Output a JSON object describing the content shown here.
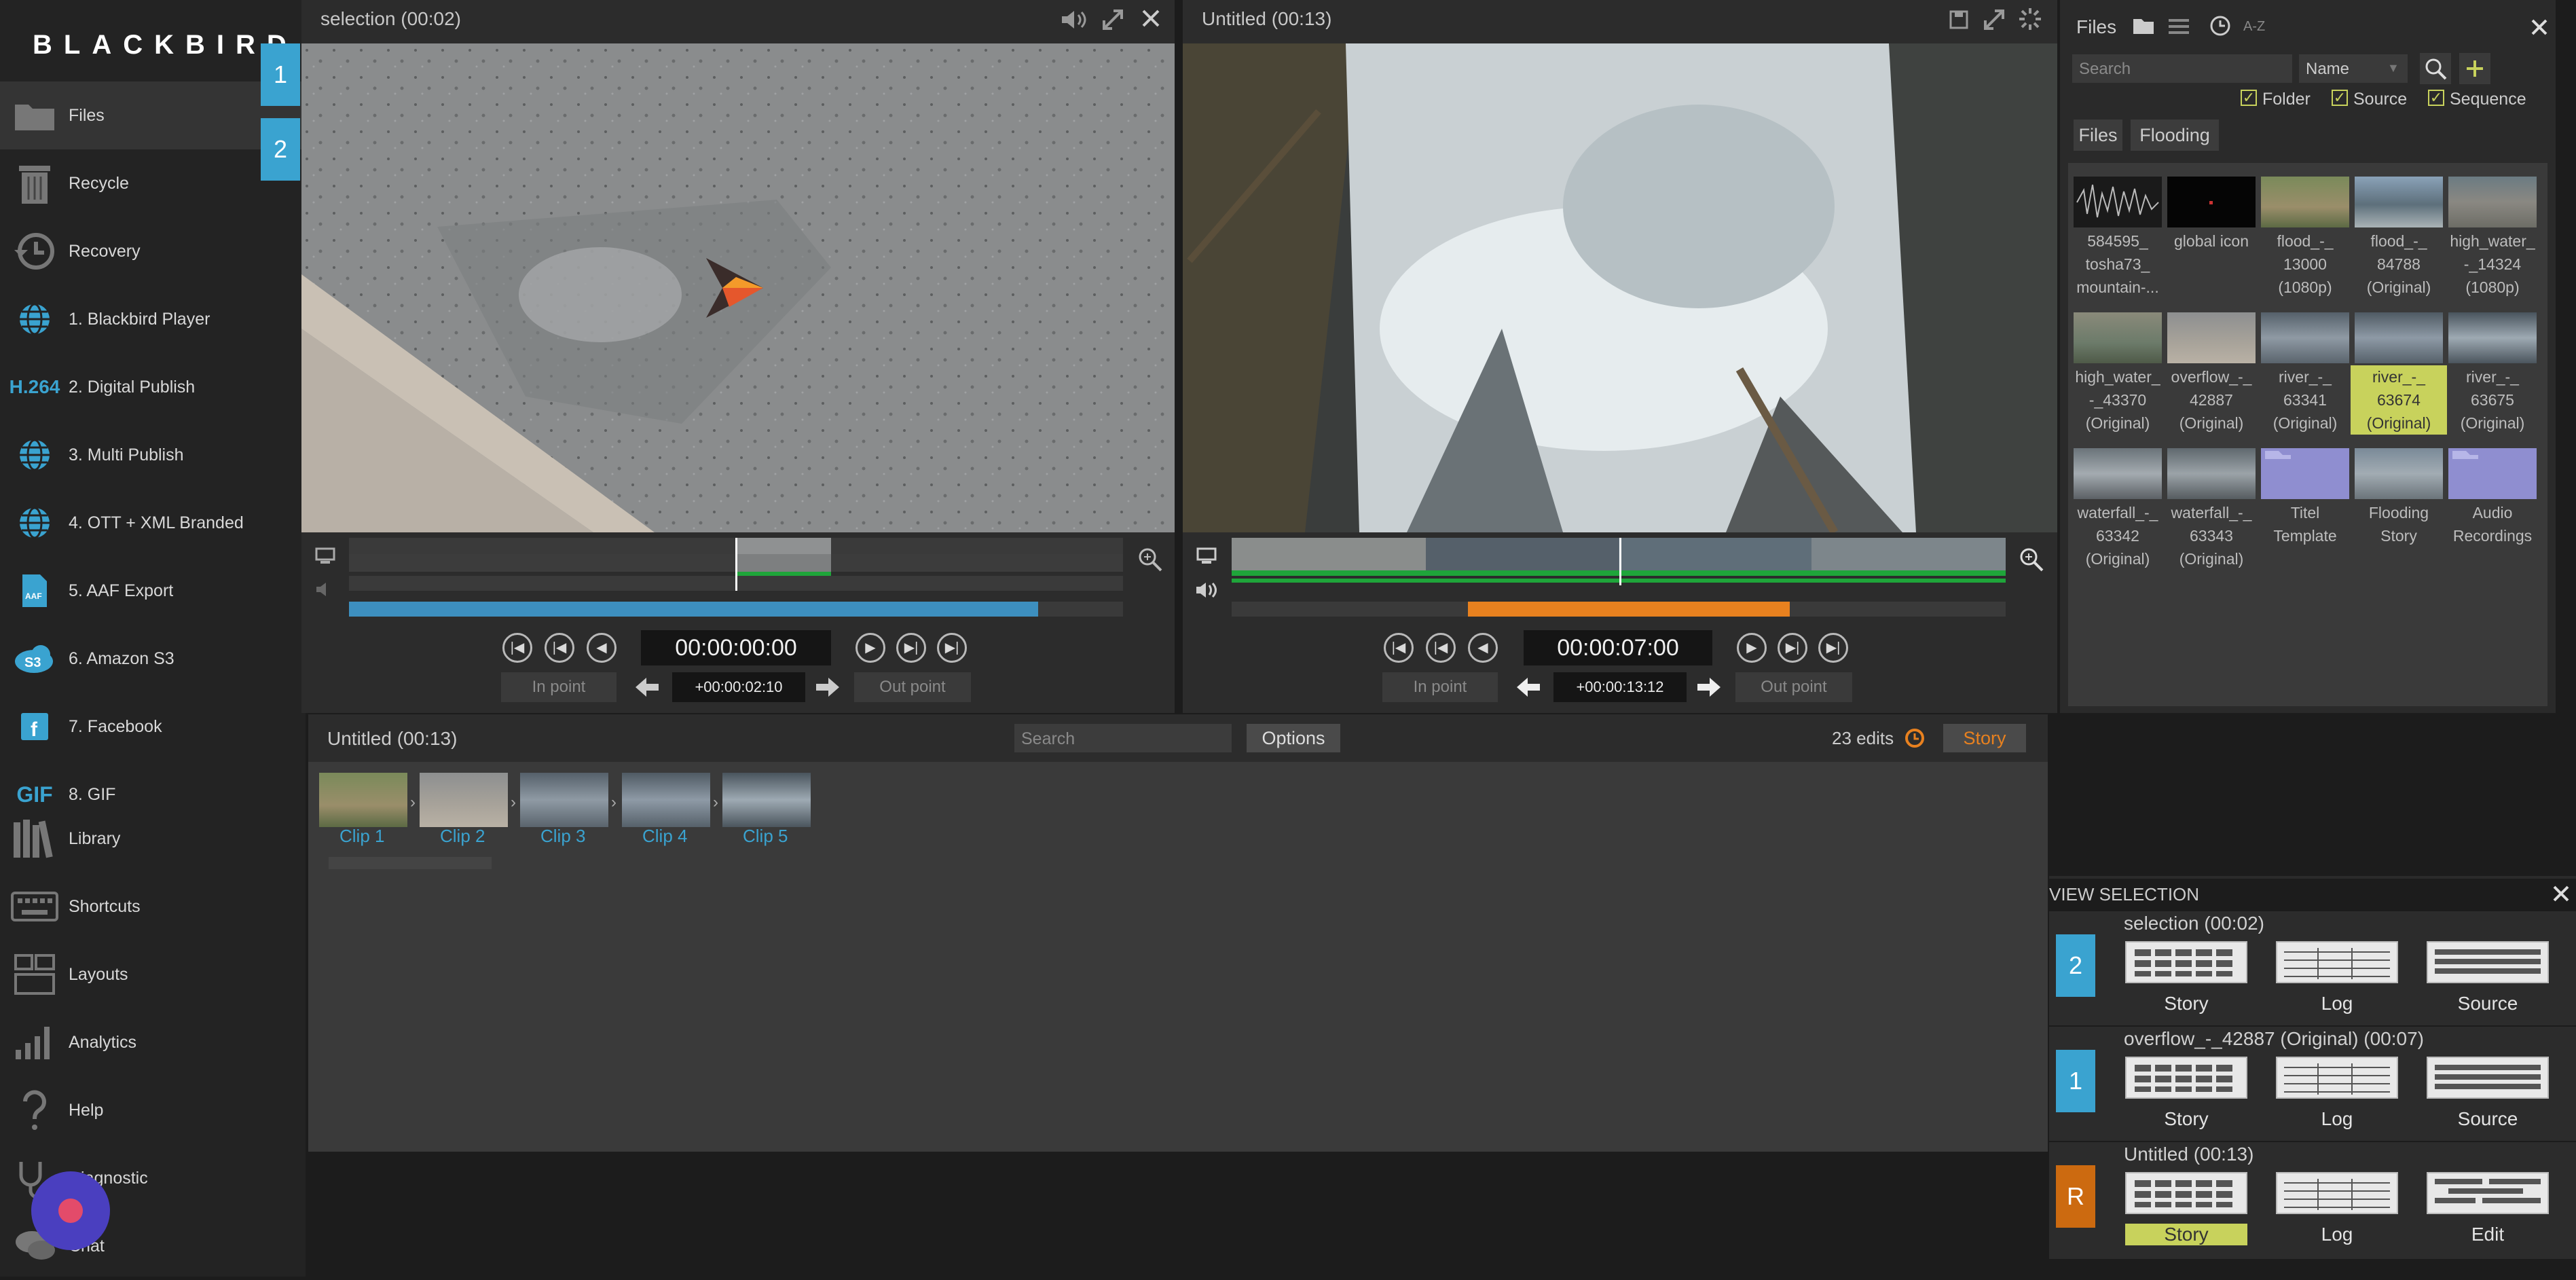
{
  "app": {
    "logo": "BLACKBIRD"
  },
  "sidebar": {
    "items": [
      {
        "label": "Files",
        "icon": "folder-icon"
      },
      {
        "label": "Recycle",
        "icon": "trash-icon"
      },
      {
        "label": "Recovery",
        "icon": "history-icon"
      },
      {
        "label": "1. Blackbird Player",
        "icon": "globe-icon"
      },
      {
        "label": "2. Digital Publish",
        "icon": "h264-icon"
      },
      {
        "label": "3. Multi Publish",
        "icon": "globe-icon"
      },
      {
        "label": "4. OTT + XML Branded",
        "icon": "globe-icon"
      },
      {
        "label": "5. AAF Export",
        "icon": "aaf-icon"
      },
      {
        "label": "6. Amazon S3",
        "icon": "s3-icon"
      },
      {
        "label": "7. Facebook",
        "icon": "facebook-icon"
      },
      {
        "label": "8. GIF",
        "icon": "gif-icon"
      },
      {
        "label": "Library",
        "icon": "library-icon"
      },
      {
        "label": "Shortcuts",
        "icon": "keyboard-icon"
      },
      {
        "label": "Layouts",
        "icon": "layouts-icon"
      },
      {
        "label": "Analytics",
        "icon": "analytics-icon"
      },
      {
        "label": "Help",
        "icon": "help-icon"
      },
      {
        "label": "Diagnostic",
        "icon": "stethoscope-icon"
      },
      {
        "label": "Chat",
        "icon": "chat-icon"
      }
    ],
    "tabs": [
      "1",
      "2"
    ],
    "h264": "H.264",
    "gif": "GIF"
  },
  "viewer_left": {
    "title": "selection (00:02)",
    "timecode": "00:00:00:00",
    "in_point": "In point",
    "out_point": "Out point",
    "duration": "+00:00:02:10",
    "progress": 0.89
  },
  "viewer_right": {
    "title": "Untitled (00:13)",
    "timecode": "00:00:07:00",
    "in_point": "In point",
    "out_point": "Out point",
    "duration": "+00:00:13:12"
  },
  "files_panel": {
    "title": "Files",
    "sort_label": "A-Z",
    "search_placeholder": "Search",
    "sort_value": "Name",
    "filters": [
      {
        "label": "Folder",
        "checked": true
      },
      {
        "label": "Source",
        "checked": true
      },
      {
        "label": "Sequence",
        "checked": true
      }
    ],
    "tabs": [
      "Files",
      "Flooding"
    ],
    "items": [
      {
        "name": "584595_\ntosha73_\nmountain-..."
      },
      {
        "name": "global icon"
      },
      {
        "name": "flood_-_\n13000\n(1080p)"
      },
      {
        "name": "flood_-_\n84788\n(Original)"
      },
      {
        "name": "high_water_\n-_14324\n(1080p)"
      },
      {
        "name": "high_water_\n-_43370\n(Original)"
      },
      {
        "name": "overflow_-_\n42887\n(Original)"
      },
      {
        "name": "river_-_\n63341\n(Original)"
      },
      {
        "name": "river_-_\n63674\n(Original)"
      },
      {
        "name": "river_-_\n63675\n(Original)"
      },
      {
        "name": "waterfall_-_\n63342\n(Original)"
      },
      {
        "name": "waterfall_-_\n63343\n(Original)"
      },
      {
        "name": "Titel\nTemplate"
      },
      {
        "name": "Flooding\nStory"
      },
      {
        "name": "Audio\nRecordings"
      }
    ]
  },
  "story": {
    "title": "Untitled (00:13)",
    "search_placeholder": "Search",
    "options": "Options",
    "edits": "23 edits",
    "story_btn": "Story",
    "clips": [
      "Clip 1",
      "Clip 2",
      "Clip 3",
      "Clip 4",
      "Clip 5"
    ]
  },
  "view_selection": {
    "title": "VIEW SELECTION",
    "rows": [
      {
        "badge": "2",
        "title": "selection (00:02)",
        "views": [
          "Story",
          "Log",
          "Source"
        ],
        "active": -1
      },
      {
        "badge": "1",
        "title": "overflow_-_42887 (Original) (00:07)",
        "views": [
          "Story",
          "Log",
          "Source"
        ],
        "active": -1
      },
      {
        "badge": "R",
        "title": "Untitled (00:13)",
        "views": [
          "Story",
          "Log",
          "Edit"
        ],
        "active": 0
      }
    ]
  },
  "colors": {
    "accent_blue": "#3aa3d0",
    "accent_orange": "#e8811f",
    "accent_yellow": "#c8d25c",
    "record_red": "#e34b6a",
    "badge_orange": "#cc6a10"
  }
}
